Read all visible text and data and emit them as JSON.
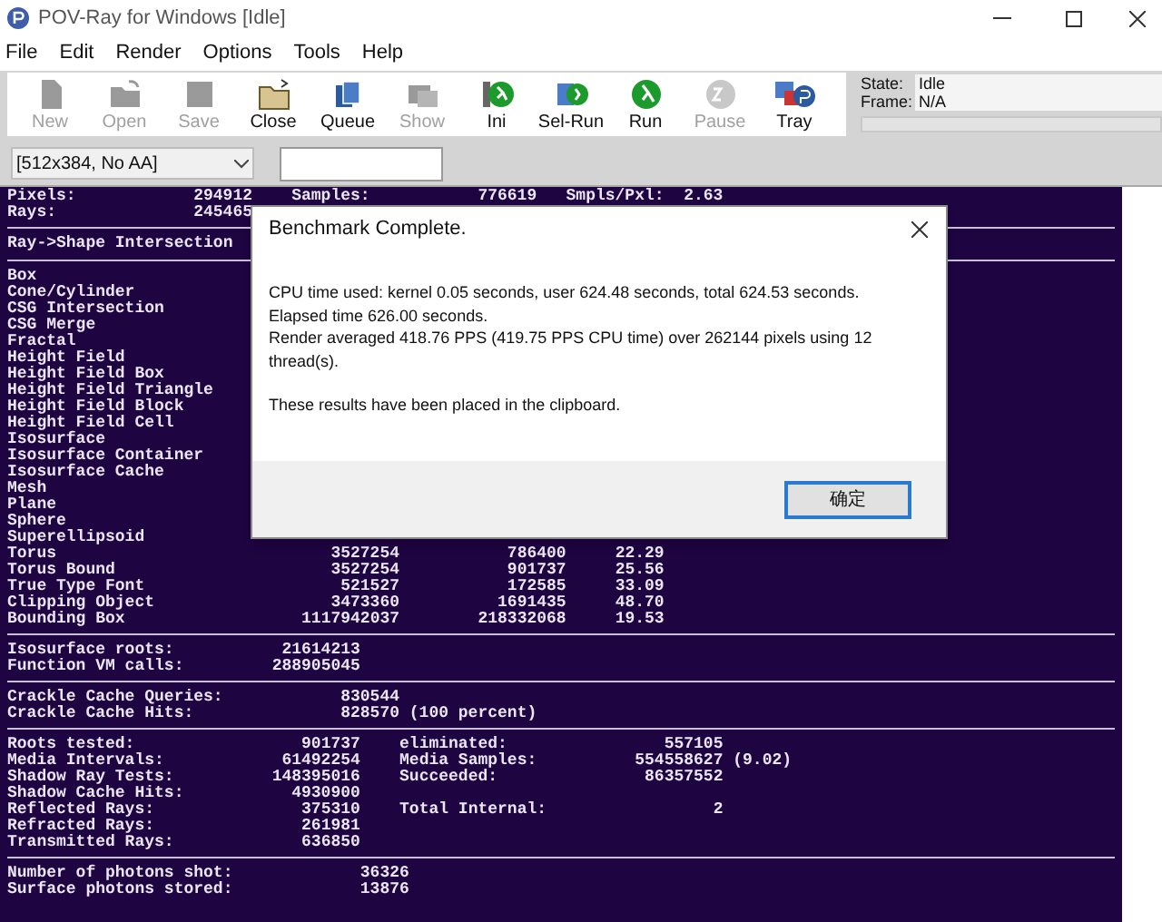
{
  "window": {
    "title": "POV-Ray for Windows [Idle]"
  },
  "menu": [
    "File",
    "Edit",
    "Render",
    "Options",
    "Tools",
    "Help"
  ],
  "toolbar": [
    {
      "label": "New",
      "disabled": true
    },
    {
      "label": "Open",
      "disabled": true
    },
    {
      "label": "Save",
      "disabled": true
    },
    {
      "label": "Close",
      "disabled": false
    },
    {
      "label": "Queue",
      "disabled": false
    },
    {
      "label": "Show",
      "disabled": true
    },
    {
      "label": "Ini",
      "disabled": false
    },
    {
      "label": "Sel-Run",
      "disabled": false
    },
    {
      "label": "Run",
      "disabled": false
    },
    {
      "label": "Pause",
      "disabled": true
    },
    {
      "label": "Tray",
      "disabled": false
    }
  ],
  "status": {
    "state_label": "State:",
    "state": "Idle",
    "frame_label": "Frame:",
    "frame": "N/A",
    "progress": {
      "level": 0
    }
  },
  "resolution": {
    "value": "[512x384, No AA]"
  },
  "output": {
    "sections": [
      {
        "kind": "header",
        "rows": [
          [
            "Pixels:",
            "294912",
            "Samples:",
            "776619",
            "Smpls/Pxl:",
            "2.63"
          ],
          [
            "Rays:",
            "245465"
          ]
        ]
      },
      {
        "kind": "title",
        "rows": [
          [
            "Ray->Shape Intersection"
          ]
        ]
      },
      {
        "kind": "shapes",
        "rows": [
          [
            "Box"
          ],
          [
            "Cone/Cylinder"
          ],
          [
            "CSG Intersection"
          ],
          [
            "CSG Merge"
          ],
          [
            "Fractal"
          ],
          [
            "Height Field"
          ],
          [
            "Height Field Box"
          ],
          [
            "Height Field Triangle"
          ],
          [
            "Height Field Block"
          ],
          [
            "Height Field Cell"
          ],
          [
            "Isosurface"
          ],
          [
            "Isosurface Container"
          ],
          [
            "Isosurface Cache"
          ],
          [
            "Mesh"
          ],
          [
            "Plane"
          ],
          [
            "Sphere"
          ],
          [
            "Superellipsoid"
          ],
          [
            "Torus",
            "3527254",
            "786400",
            "22.29"
          ],
          [
            "Torus Bound",
            "3527254",
            "901737",
            "25.56"
          ],
          [
            "True Type Font",
            "521527",
            "172585",
            "33.09"
          ],
          [
            "Clipping Object",
            "3473360",
            "1691435",
            "48.70"
          ],
          [
            "Bounding Box",
            "1117942037",
            "218332068",
            "19.53"
          ]
        ]
      },
      {
        "kind": "pair",
        "rows": [
          [
            "Isosurface roots:",
            "21614213"
          ],
          [
            "Function VM calls:",
            "288905045"
          ]
        ]
      },
      {
        "kind": "crackle",
        "rows": [
          [
            "Crackle Cache Queries:",
            "830544"
          ],
          [
            "Crackle Cache Hits:",
            "828570",
            "(100 percent)"
          ]
        ]
      },
      {
        "kind": "quad",
        "rows": [
          [
            "Roots tested:",
            "901737",
            "eliminated:",
            "557105"
          ],
          [
            "Media Intervals:",
            "61492254",
            "Media Samples:",
            "554558627",
            "(9.02)"
          ],
          [
            "Shadow Ray Tests:",
            "148395016",
            "Succeeded:",
            "86357552"
          ],
          [
            "Shadow Cache Hits:",
            "4930900"
          ],
          [
            "Reflected Rays:",
            "375310",
            "Total Internal:",
            "2"
          ],
          [
            "Refracted Rays:",
            "261981"
          ],
          [
            "Transmitted Rays:",
            "636850"
          ]
        ]
      },
      {
        "kind": "photon",
        "rows": [
          [
            "Number of photons shot:",
            "36326"
          ],
          [
            "Surface photons stored:",
            "13876"
          ]
        ]
      }
    ]
  },
  "dialog": {
    "title": "Benchmark Complete.",
    "lines": [
      "CPU time used: kernel 0.05 seconds, user 624.48 seconds, total 624.53 seconds.",
      "Elapsed time 626.00 seconds.",
      "Render averaged 418.76 PPS (419.75 PPS CPU time) over 262144 pixels using 12 thread(s)."
    ],
    "note": "These results have been placed in the clipboard.",
    "button": "确定"
  }
}
